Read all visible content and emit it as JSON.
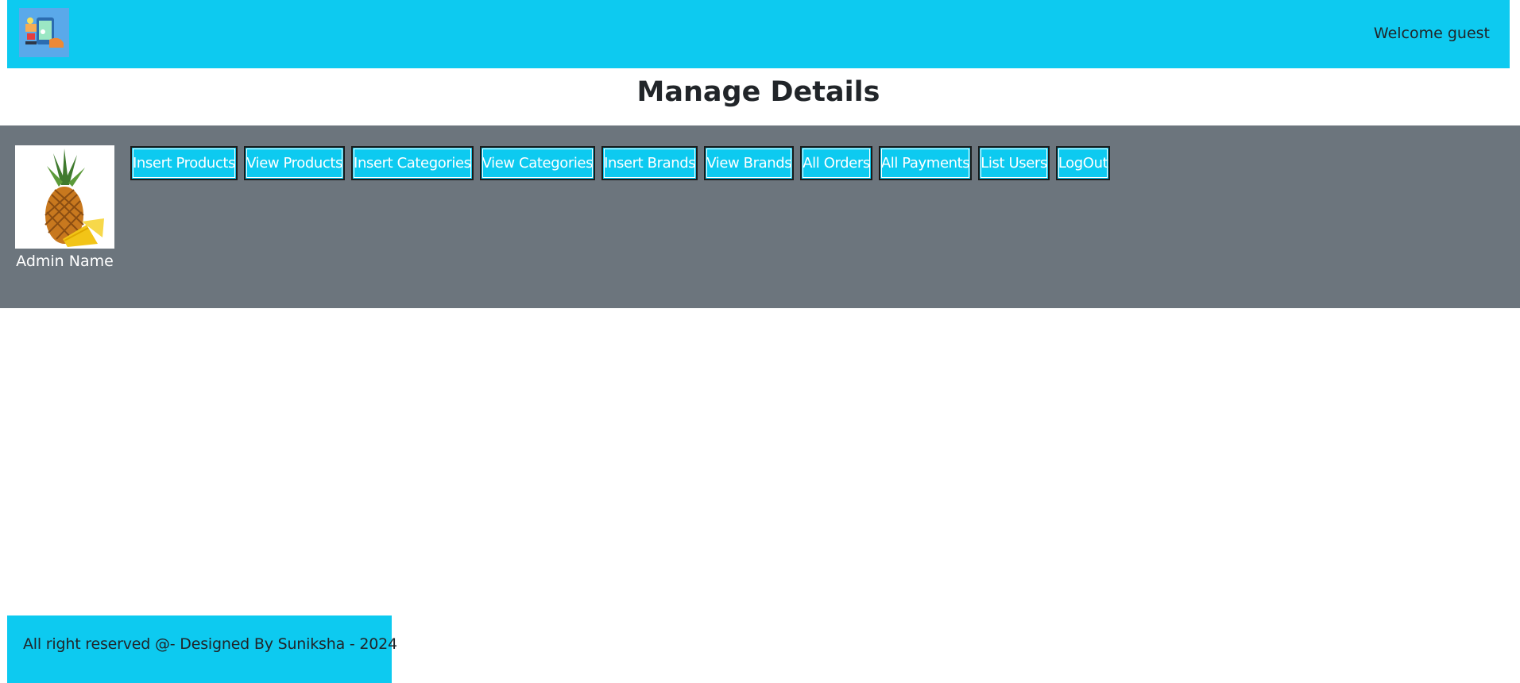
{
  "header": {
    "logo_icon": "shopping-logo-icon",
    "welcome_text": "Welcome guest",
    "accent_color": "#0dcaf0"
  },
  "page": {
    "title": "Manage Details"
  },
  "admin": {
    "avatar_icon": "pineapple-image",
    "name": "Admin Name",
    "panel_color": "#6c757d"
  },
  "nav": {
    "buttons": [
      "Insert Products",
      "View Products",
      "Insert Categories",
      "View Categories",
      "Insert Brands",
      "View Brands",
      "All Orders",
      "All Payments",
      "List Users",
      "LogOut"
    ]
  },
  "footer": {
    "text": "All right reserved @- Designed By Suniksha - 2024"
  }
}
